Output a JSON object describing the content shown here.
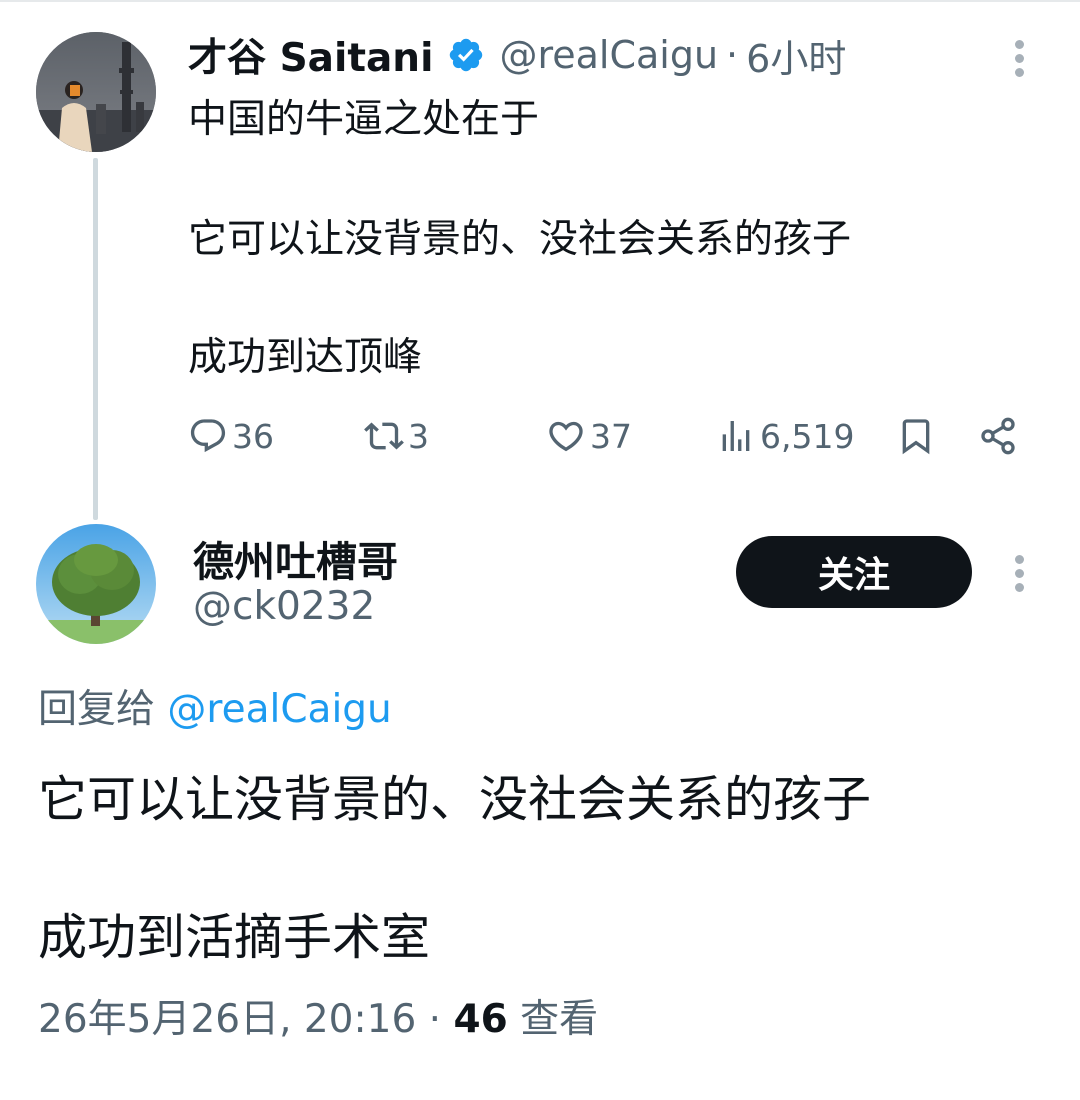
{
  "parent_tweet": {
    "display_name": "才谷 Saitani",
    "handle": "@realCaigu",
    "separator": "·",
    "time": "6小时",
    "text_lines": [
      "中国的牛逼之处在于",
      "它可以让没背景的、没社会关系的孩子",
      "成功到达顶峰"
    ],
    "reply_count": "36",
    "retweet_count": "3",
    "like_count": "37",
    "view_count": "6,519",
    "icons": [
      "verified-badge-icon",
      "more-vert-icon",
      "reply-icon",
      "retweet-icon",
      "like-icon",
      "views-icon",
      "bookmark-icon",
      "share-icon"
    ]
  },
  "reply_tweet": {
    "display_name": "德州吐槽哥",
    "handle": "@ck0232",
    "follow_label": "关注",
    "replying_prefix": "回复给",
    "replying_mention": "@realCaigu",
    "text_lines": [
      "它可以让没背景的、没社会关系的孩子",
      "成功到活摘手术室"
    ],
    "date_time": "26年5月26日, 20:16",
    "separator": "·",
    "views_count": "46",
    "views_label": "查看"
  },
  "colors": {
    "text_primary": "#0f1419",
    "text_secondary": "#536471",
    "accent_blue": "#1d9bf0",
    "verified_blue": "#1d9bf0",
    "follow_button_bg": "#0f1419",
    "thread_line": "#cfd9de"
  }
}
